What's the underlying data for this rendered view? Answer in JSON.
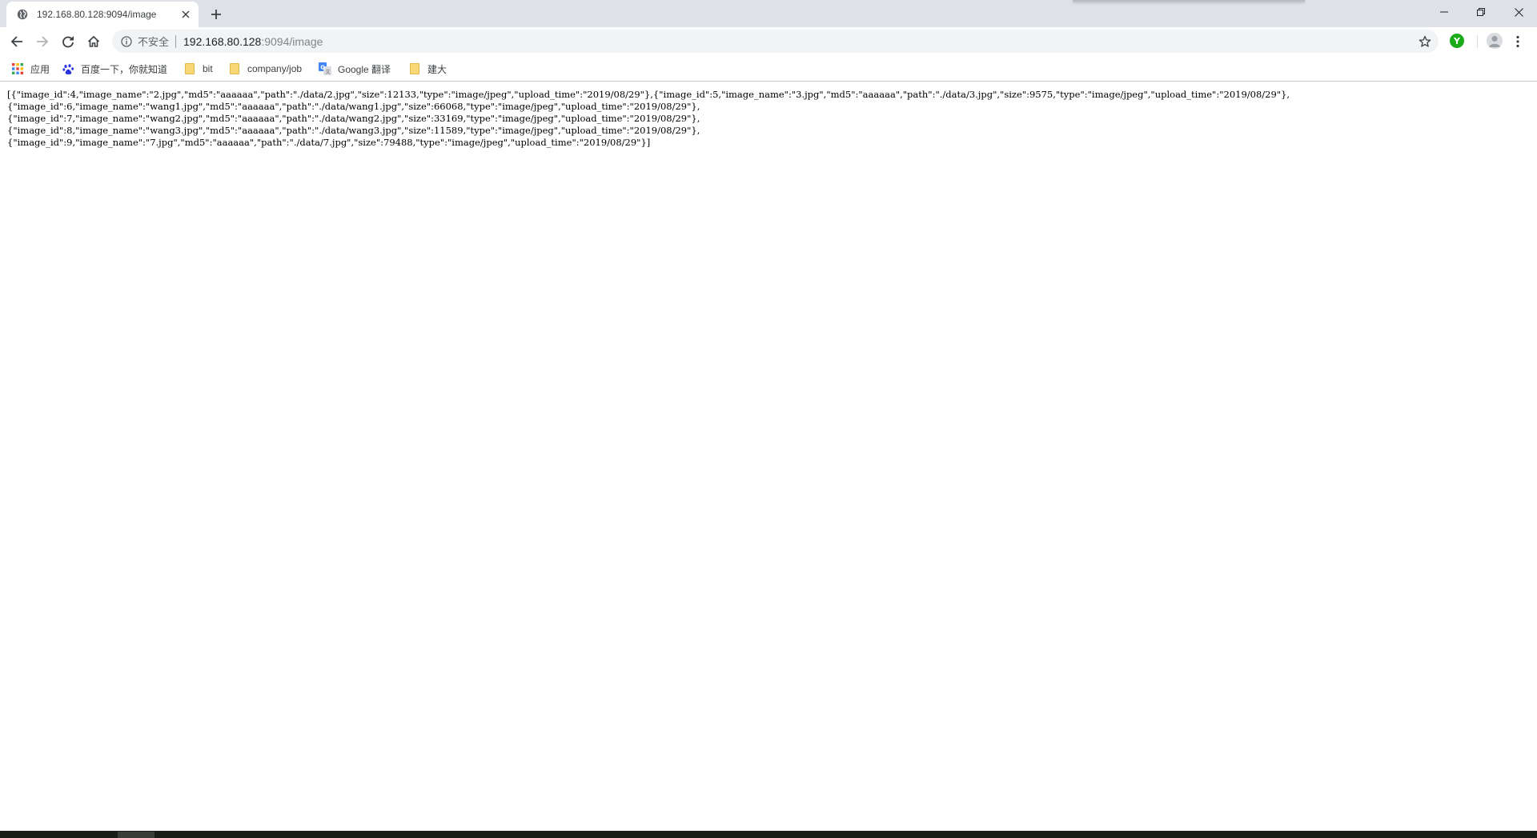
{
  "tab": {
    "title": "192.168.80.128:9094/image",
    "favicon": "globe-icon"
  },
  "window_controls": [
    "minimize-icon",
    "maximize-icon",
    "close-icon"
  ],
  "toolbar": {
    "security_label": "不安全",
    "url_host": "192.168.80.128",
    "url_rest": ":9094/image",
    "extension_label": "Y"
  },
  "bookmarks": {
    "apps": "应用",
    "items": [
      {
        "label": "百度一下，你就知道",
        "icon": "baidu-paw-icon"
      },
      {
        "label": "bit",
        "icon": "folder-icon"
      },
      {
        "label": "company/job",
        "icon": "folder-icon"
      },
      {
        "label": "Google 翻译",
        "icon": "google-translate-icon"
      },
      {
        "label": "建大",
        "icon": "folder-icon"
      }
    ]
  },
  "page": {
    "lines": [
      "[{\"image_id\":4,\"image_name\":\"2.jpg\",\"md5\":\"aaaaaa\",\"path\":\"./data/2.jpg\",\"size\":12133,\"type\":\"image/jpeg\",\"upload_time\":\"2019/08/29\"},{\"image_id\":5,\"image_name\":\"3.jpg\",\"md5\":\"aaaaaa\",\"path\":\"./data/3.jpg\",\"size\":9575,\"type\":\"image/jpeg\",\"upload_time\":\"2019/08/29\"},",
      "{\"image_id\":6,\"image_name\":\"wang1.jpg\",\"md5\":\"aaaaaa\",\"path\":\"./data/wang1.jpg\",\"size\":66068,\"type\":\"image/jpeg\",\"upload_time\":\"2019/08/29\"},",
      "{\"image_id\":7,\"image_name\":\"wang2.jpg\",\"md5\":\"aaaaaa\",\"path\":\"./data/wang2.jpg\",\"size\":33169,\"type\":\"image/jpeg\",\"upload_time\":\"2019/08/29\"},",
      "{\"image_id\":8,\"image_name\":\"wang3.jpg\",\"md5\":\"aaaaaa\",\"path\":\"./data/wang3.jpg\",\"size\":11589,\"type\":\"image/jpeg\",\"upload_time\":\"2019/08/29\"},",
      "{\"image_id\":9,\"image_name\":\"7.jpg\",\"md5\":\"aaaaaa\",\"path\":\"./data/7.jpg\",\"size\":79488,\"type\":\"image/jpeg\",\"upload_time\":\"2019/08/29\"}]"
    ]
  }
}
